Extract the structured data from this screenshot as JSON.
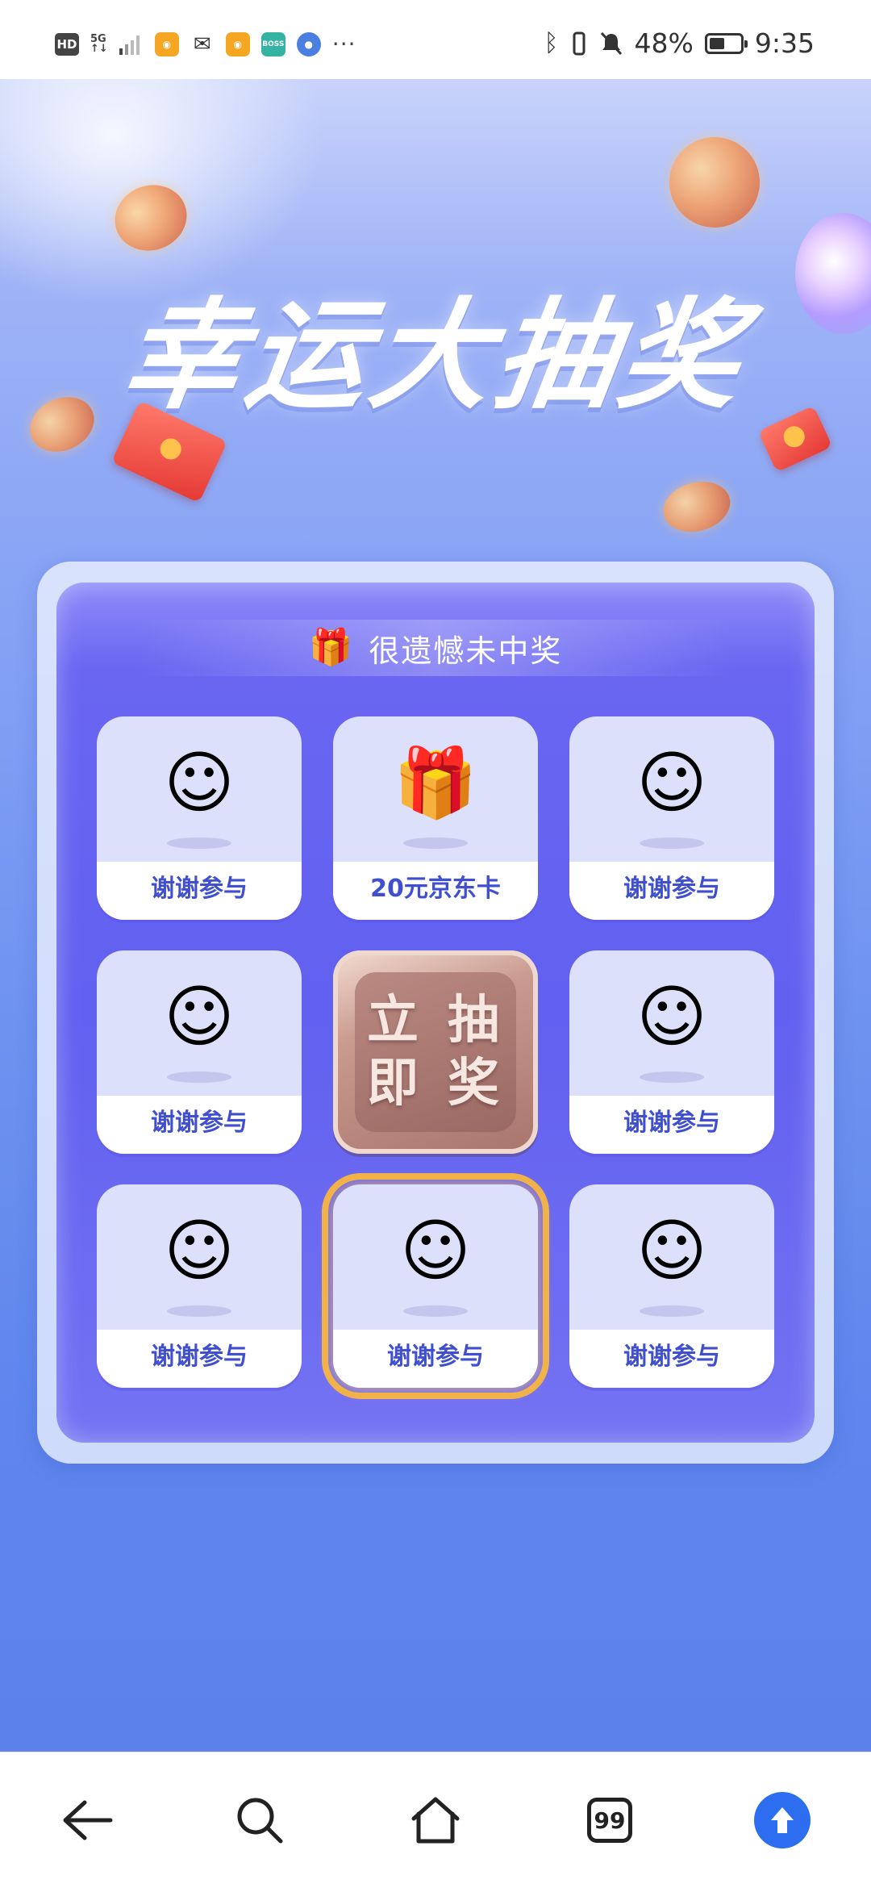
{
  "status_bar": {
    "hd": "HD",
    "network": "5G",
    "battery_percent": "48%",
    "time": "9:35",
    "more": "···"
  },
  "hero": {
    "title": "幸运大抽奖"
  },
  "lottery": {
    "result_text": "很遗憾未中奖",
    "draw_button_label": "立即\n抽奖",
    "cells": [
      {
        "icon": "smile-face-icon",
        "label": "谢谢参与"
      },
      {
        "icon": "gift-box-icon",
        "label": "20元京东卡"
      },
      {
        "icon": "smile-face-icon",
        "label": "谢谢参与"
      },
      {
        "icon": "smile-face-icon",
        "label": "谢谢参与"
      },
      {
        "icon": "smile-face-icon",
        "label": "谢谢参与"
      },
      {
        "icon": "smile-face-icon",
        "label": "谢谢参与"
      },
      {
        "icon": "smile-face-icon",
        "label": "谢谢参与"
      },
      {
        "icon": "smile-face-icon",
        "label": "谢谢参与"
      }
    ]
  },
  "nav": {
    "tabs_count": "99",
    "items": [
      "back-arrow-icon",
      "search-icon",
      "home-icon",
      "tabs-icon",
      "upload-arrow-icon"
    ]
  },
  "colors": {
    "accent_blue": "#2d6ef0",
    "label_blue": "#3f4fd0",
    "highlight_gold": "#f2b24a"
  }
}
